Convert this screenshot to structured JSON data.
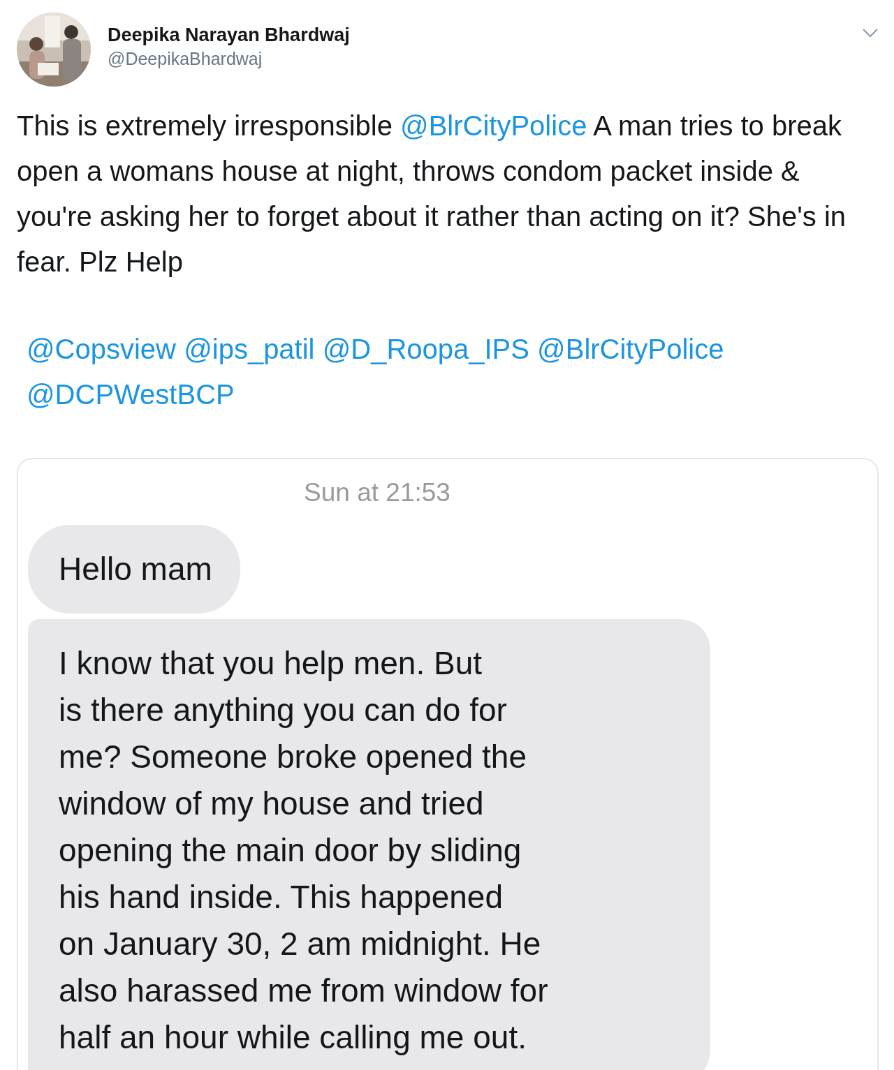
{
  "author": {
    "name": "Deepika Narayan Bhardwaj",
    "handle": "@DeepikaBhardwaj"
  },
  "tweet": {
    "body": [
      {
        "kind": "text",
        "text": "This is extremely irresponsible "
      },
      {
        "kind": "mention",
        "text": "@BlrCityPolice"
      },
      {
        "kind": "text",
        "text": " A man tries to break open a womans house at night, throws condom packet inside & you're asking her to forget about it rather than acting on it? She's in fear. Plz Help"
      }
    ],
    "mentions": [
      "@Copsview",
      "@ips_patil",
      "@D_Roopa_IPS",
      "@BlrCityPolice",
      "@DCPWestBCP"
    ]
  },
  "chat": {
    "timestamp": "Sun at 21:53",
    "messages": [
      {
        "lines": [
          "Hello mam"
        ]
      },
      {
        "lines": [
          "I know that you help men. But",
          "is there anything you can do for",
          "me? Someone broke opened the",
          "window of my house and tried",
          "opening the main door by sliding",
          "his hand inside. This happened",
          "on January 30, 2 am midnight. He",
          "also harassed me from window for",
          "half an hour while calling me out."
        ]
      }
    ]
  }
}
